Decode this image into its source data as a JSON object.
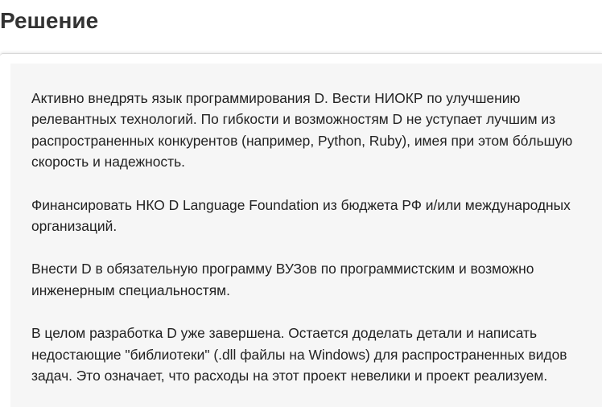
{
  "section": {
    "title": "Решение"
  },
  "paragraphs": [
    "Активно внедрять язык программирования D. Вести НИОКР по улучшению релевантных технологий. По гибкости и возможностям D не уступает лучшим из распространенных конкурентов (например, Python, Ruby), имея при этом бóльшую скорость и надежность.",
    "Финансировать НКО D Language Foundation из бюджета РФ и/или международных организаций.",
    "Внести D в обязательную программу ВУЗов по программистским и возможно инженерным специальностям.",
    "В целом разработка D уже завершена. Остается доделать детали и написать недостающие \"библиотеки\" (.dll файлы на Windows) для распространенных видов задач. Это означает, что расходы на этот проект невелики и проект реализуем."
  ]
}
